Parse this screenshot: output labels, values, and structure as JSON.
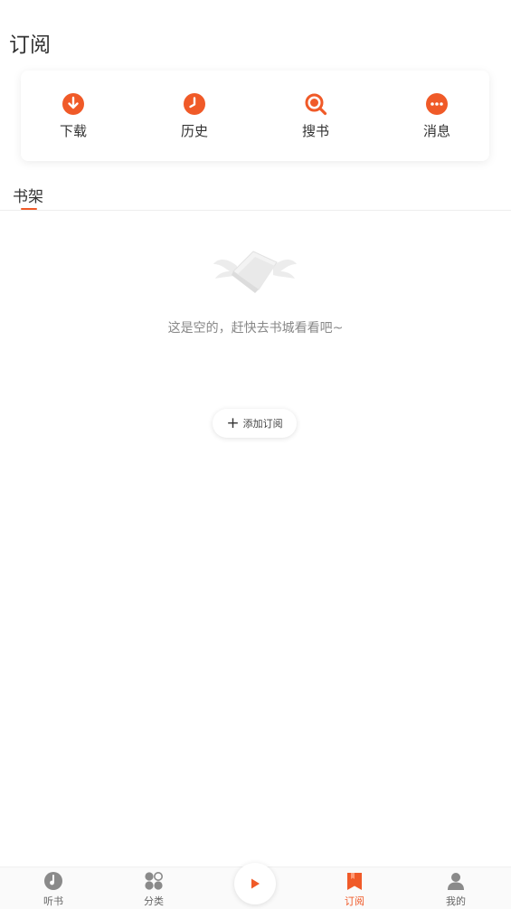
{
  "header": {
    "title": "订阅"
  },
  "quick_actions": [
    {
      "label": "下载",
      "icon": "download-icon"
    },
    {
      "label": "历史",
      "icon": "clock-icon"
    },
    {
      "label": "搜书",
      "icon": "search-icon"
    },
    {
      "label": "消息",
      "icon": "message-icon"
    }
  ],
  "shelf": {
    "tab_label": "书架",
    "empty_text": "这是空的，赶快去书城看看吧~",
    "add_button_label": "添加订阅"
  },
  "bottom_nav": [
    {
      "label": "听书",
      "icon": "listen-icon",
      "active": false
    },
    {
      "label": "分类",
      "icon": "category-icon",
      "active": false
    },
    {
      "label": "订阅",
      "icon": "subscribe-icon",
      "active": true
    },
    {
      "label": "我的",
      "icon": "profile-icon",
      "active": false
    }
  ],
  "colors": {
    "accent": "#f05a28",
    "inactive": "#888888"
  }
}
